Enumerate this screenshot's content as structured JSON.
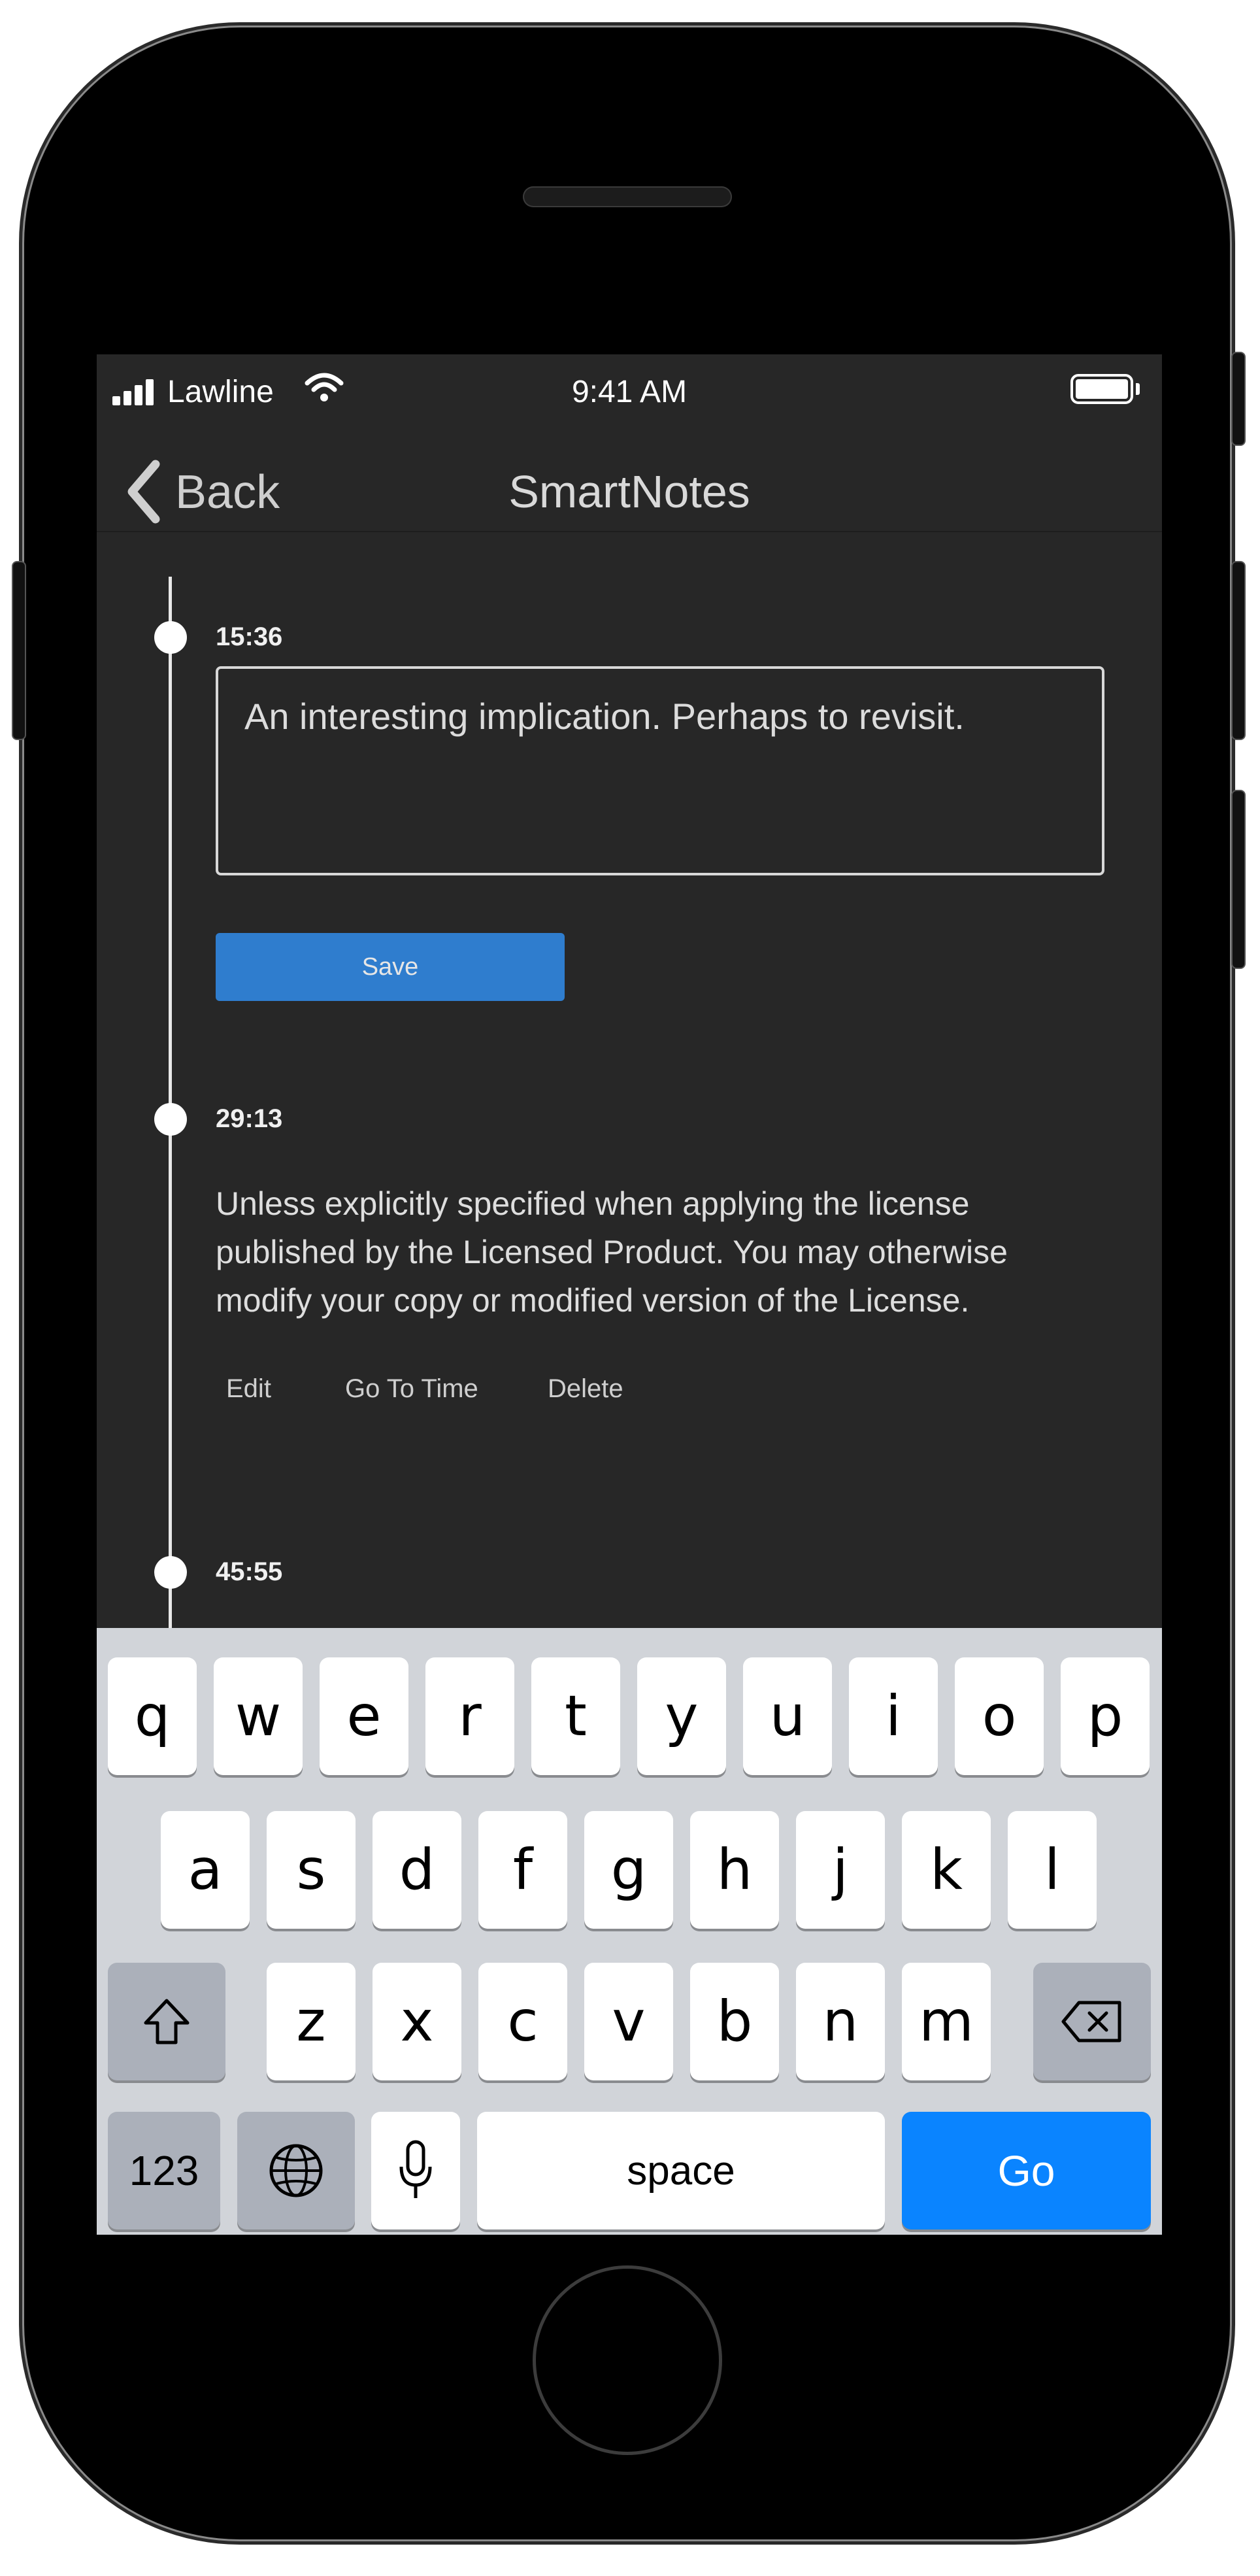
{
  "status_bar": {
    "carrier": "Lawline",
    "time": "9:41 AM"
  },
  "nav": {
    "back_label": "Back",
    "title": "SmartNotes"
  },
  "notes": [
    {
      "timestamp": "15:36",
      "input_value": "An interesting implication. Perhaps to revisit.",
      "save_label": "Save"
    },
    {
      "timestamp": "29:13",
      "lines": [
        "Unless explicitly specified when applying the license",
        "published by the Licensed Product. You may otherwise",
        "modify your copy or modified version of the License."
      ],
      "actions": {
        "edit": "Edit",
        "goto": "Go To Time",
        "delete": "Delete"
      }
    },
    {
      "timestamp": "45:55"
    }
  ],
  "keyboard": {
    "row1": [
      "q",
      "w",
      "e",
      "r",
      "t",
      "y",
      "u",
      "i",
      "o",
      "p"
    ],
    "row2": [
      "a",
      "s",
      "d",
      "f",
      "g",
      "h",
      "j",
      "k",
      "l"
    ],
    "row3": [
      "z",
      "x",
      "c",
      "v",
      "b",
      "n",
      "m"
    ],
    "numbers_label": "123",
    "space_label": "space",
    "go_label": "Go"
  },
  "colors": {
    "screen_bg": "#272727",
    "save_button": "#2f7dce",
    "go_key": "#0a84ff",
    "keyboard_bg": "#d1d4d9"
  }
}
